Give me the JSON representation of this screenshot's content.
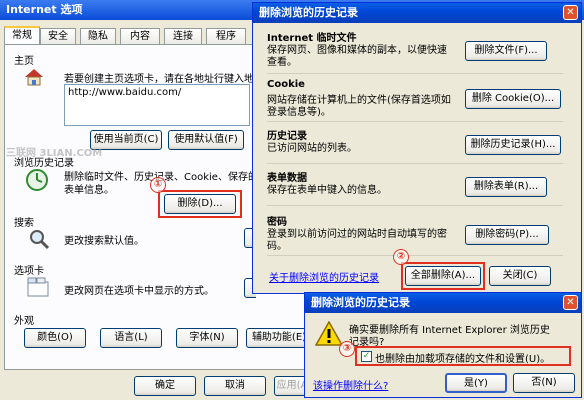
{
  "main_window": {
    "title": "Internet 选项",
    "tabs": [
      "常规",
      "安全",
      "隐私",
      "内容",
      "连接",
      "程序"
    ],
    "home": {
      "section": "主页",
      "hint": "若要创建主页选项卡，请在各地址行键入地",
      "url": "http://www.baidu.com/",
      "btn_current": "使用当前页(C)",
      "btn_default": "使用默认值(F)"
    },
    "history": {
      "section": "浏览历史记录",
      "desc_line1": "删除临时文件、历史记录、Cookie、保存的",
      "desc_line2": "表单信息。",
      "btn_delete": "删除(D)..."
    },
    "search": {
      "section": "搜索",
      "desc": "更改搜索默认值。"
    },
    "tabs_section": {
      "section": "选项卡",
      "desc": "更改网页在选项卡中显示的方式。"
    },
    "appearance": {
      "section": "外观",
      "btn_color": "颜色(O)",
      "btn_language": "语言(L)",
      "btn_font": "字体(N)",
      "btn_access": "辅助功能(E)"
    },
    "btn_ok": "确定",
    "btn_cancel": "取消",
    "btn_apply": "应用(A)",
    "watermark": "三联网 3LIAN.COM"
  },
  "history_dialog": {
    "title": "删除浏览的历史记录",
    "sections": [
      {
        "heading": "Internet 临时文件",
        "desc1": "保存网页、图像和媒体的副本，以便快速",
        "desc2": "查看。",
        "button": "删除文件(F)..."
      },
      {
        "heading": "Cookie",
        "desc1": "网站存储在计算机上的文件(保存首选项如",
        "desc2": "登录信息等)。",
        "button": "删除 Cookie(O)..."
      },
      {
        "heading": "历史记录",
        "desc1": "已访问网站的列表。",
        "desc2": "",
        "button": "删除历史记录(H)..."
      },
      {
        "heading": "表单数据",
        "desc1": "保存在表单中键入的信息。",
        "desc2": "",
        "button": "删除表单(R)..."
      },
      {
        "heading": "密码",
        "desc1": "登录到以前访问过的网站时自动填写的密",
        "desc2": "码。",
        "button": "删除密码(P)..."
      }
    ],
    "about_link": "关于删除浏览的历史记录",
    "btn_delete_all": "全部删除(A)...",
    "btn_close": "关闭(C)"
  },
  "confirm_dialog": {
    "title": "删除浏览的历史记录",
    "question_line1": "确实要删除所有 Internet Explorer 浏览历史",
    "question_line2": "记录吗?",
    "checkbox_label": "也删除由加载项存储的文件和设置(U)。",
    "checkbox_checked": true,
    "link": "该操作删除什么?",
    "btn_yes": "是(Y)",
    "btn_no": "否(N)"
  },
  "annotations": [
    "①",
    "②",
    "③"
  ],
  "colors": {
    "title_blue": "#0046D5",
    "annotation_red": "#E03020",
    "dialog_bg": "#ECE9D8"
  }
}
